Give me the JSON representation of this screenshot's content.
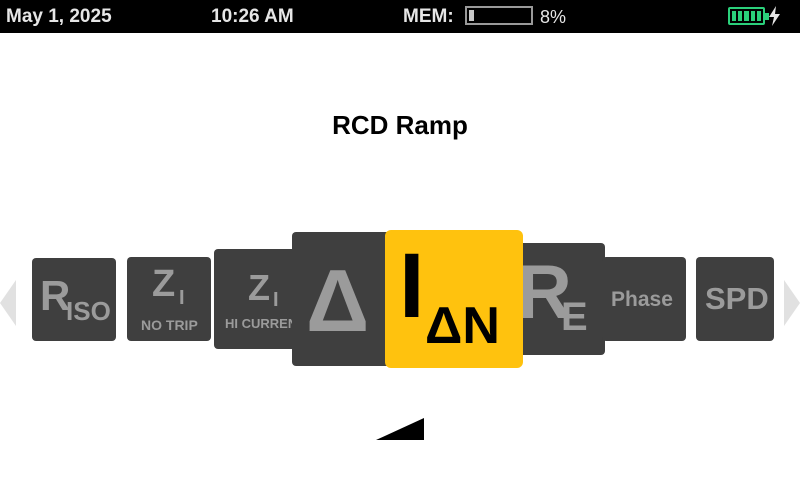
{
  "status": {
    "date": "May 1, 2025",
    "time": "10:26 AM",
    "mem_label": "MEM:",
    "mem_percent": "8%",
    "mem_fraction": 0.08,
    "battery_level": 1.0,
    "battery_color": "#2bd07b",
    "charging_icon": "bolt-icon"
  },
  "title": "RCD Ramp",
  "carousel": {
    "selected_color": "#ffc20e",
    "tile_color": "#3f3f3f",
    "tiles": [
      {
        "main": "R",
        "sub": "ISO"
      },
      {
        "main": "Z",
        "sub": "I",
        "caption": "NO TRIP"
      },
      {
        "main": "Z",
        "sub": "I",
        "caption": "HI CURREN"
      },
      {
        "main": "Δ"
      },
      {
        "main": "I",
        "sub": "ΔN",
        "selected": true
      },
      {
        "main": "R",
        "sub": "E"
      },
      {
        "main": "Phase"
      },
      {
        "main": "SPD"
      }
    ]
  }
}
